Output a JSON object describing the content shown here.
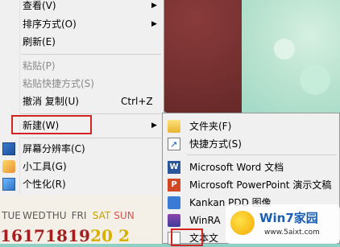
{
  "menu": {
    "items": [
      {
        "label": "查看(V)",
        "shortcut": "",
        "arrow": "▶"
      },
      {
        "label": "排序方式(O)",
        "shortcut": "",
        "arrow": "▶"
      },
      {
        "label": "刷新(E)",
        "shortcut": "",
        "arrow": ""
      },
      {
        "label": "粘贴(P)",
        "shortcut": "",
        "arrow": ""
      },
      {
        "label": "粘贴快捷方式(S)",
        "shortcut": "",
        "arrow": ""
      },
      {
        "label": "撤消 复制(U)",
        "shortcut": "Ctrl+Z",
        "arrow": ""
      },
      {
        "label": "新建(W)",
        "shortcut": "",
        "arrow": "▶"
      },
      {
        "label": "屏幕分辨率(C)",
        "shortcut": "",
        "arrow": ""
      },
      {
        "label": "小工具(G)",
        "shortcut": "",
        "arrow": ""
      },
      {
        "label": "个性化(R)",
        "shortcut": "",
        "arrow": ""
      }
    ]
  },
  "submenu": {
    "items": [
      {
        "label": "文件夹(F)",
        "icon": "folder-icon"
      },
      {
        "label": "快捷方式(S)",
        "icon": "shortcut-icon"
      },
      {
        "label": "Microsoft Word 文档",
        "icon": "word-icon"
      },
      {
        "label": "Microsoft PowerPoint 演示文稿",
        "icon": "powerpoint-icon"
      },
      {
        "label": "Kankan PDD 图像",
        "icon": "kankan-icon"
      },
      {
        "label": "WinRA",
        "icon": "winrar-icon"
      },
      {
        "label": "文本文",
        "icon": "text-file-icon"
      }
    ]
  },
  "calendar": {
    "days": [
      "TUE",
      "WED",
      "THU",
      "FRI",
      "SAT",
      "SUN"
    ],
    "dates": [
      "16",
      "17",
      "18",
      "19",
      "20",
      "2"
    ]
  },
  "watermark": {
    "title": "Win7家园",
    "url": "www.5aixt.com"
  }
}
